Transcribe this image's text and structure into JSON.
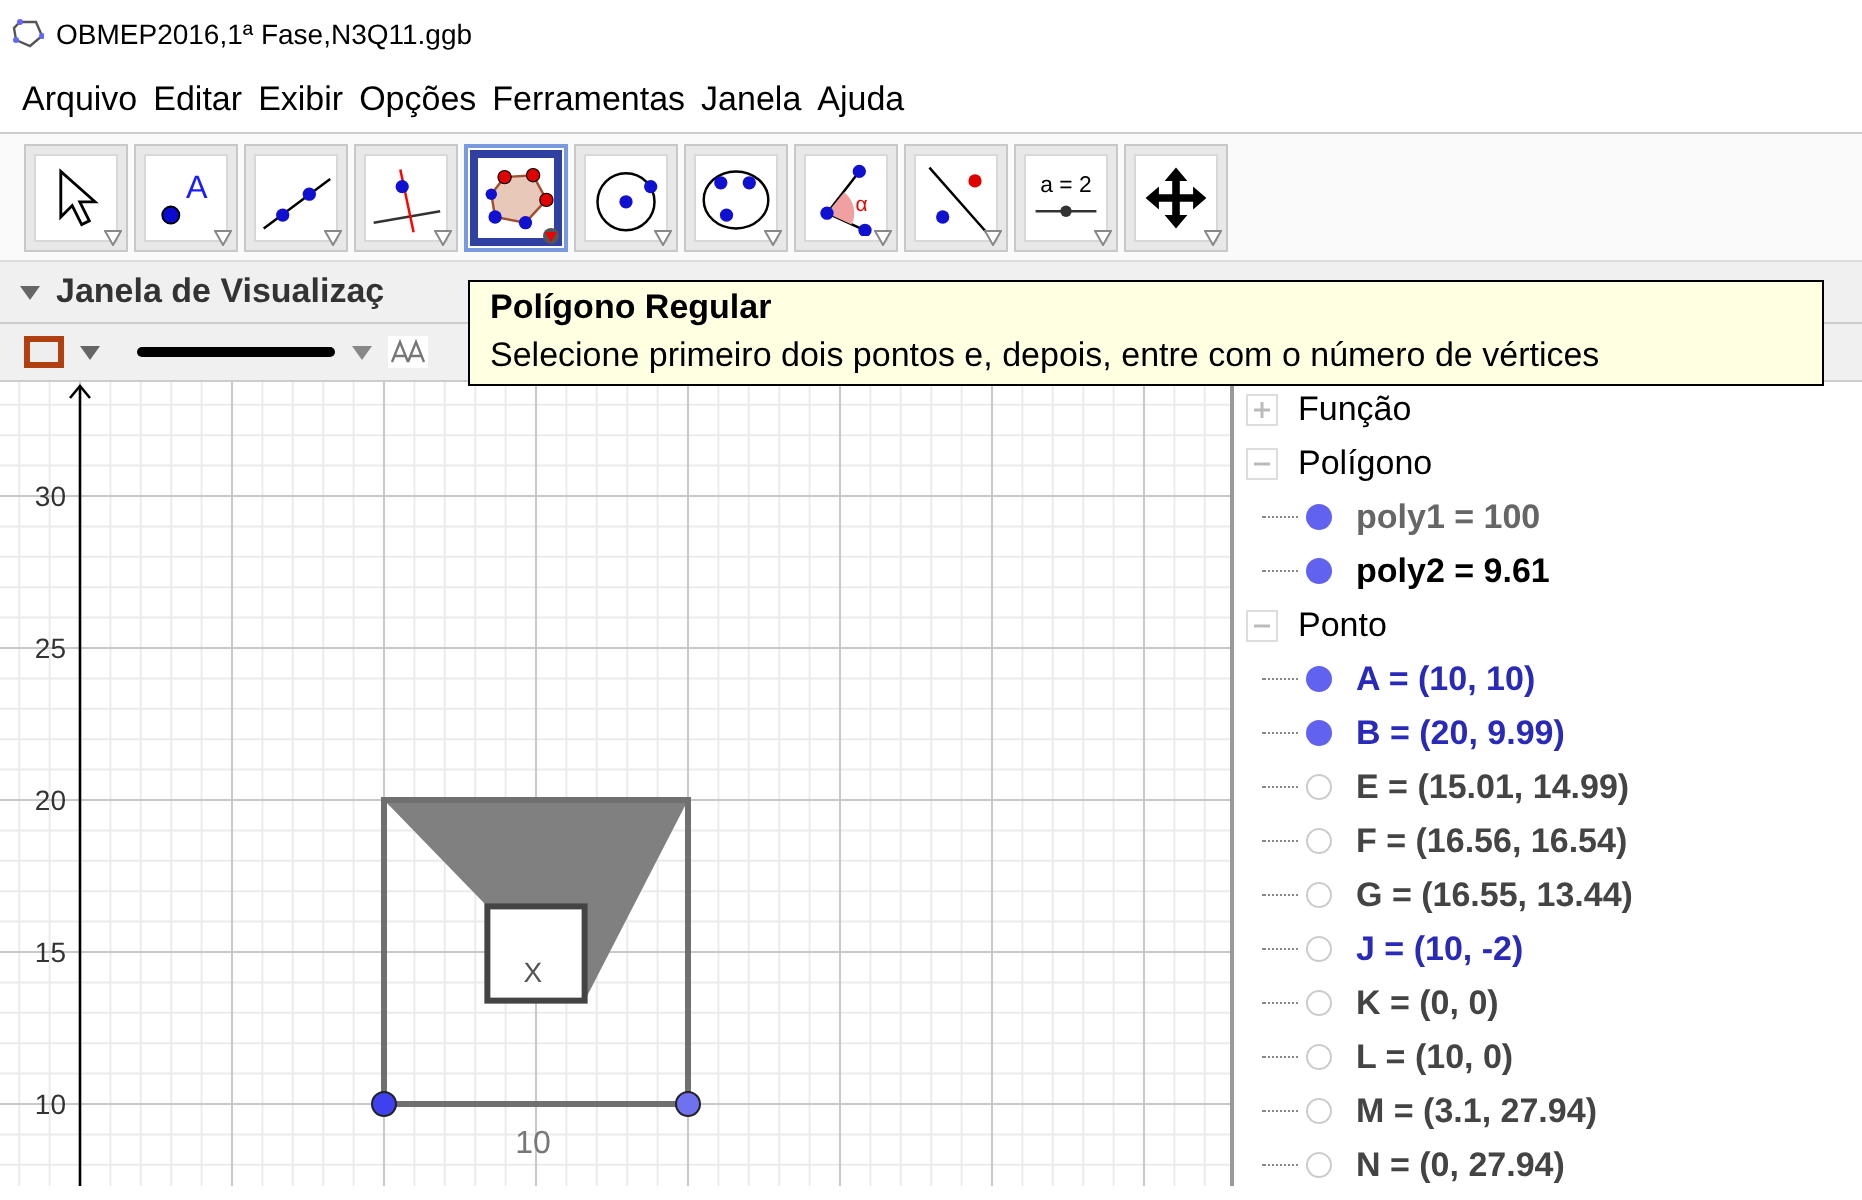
{
  "window": {
    "title": "OBMEP2016,1ª Fase,N3Q11.ggb"
  },
  "menu": [
    "Arquivo",
    "Editar",
    "Exibir",
    "Opções",
    "Ferramentas",
    "Janela",
    "Ajuda"
  ],
  "tools": [
    {
      "kind": "move",
      "selected": false
    },
    {
      "kind": "point",
      "label": "A",
      "selected": false
    },
    {
      "kind": "line",
      "selected": false
    },
    {
      "kind": "perpendicular",
      "selected": false
    },
    {
      "kind": "polygon",
      "selected": true
    },
    {
      "kind": "circle",
      "selected": false
    },
    {
      "kind": "circle3",
      "selected": false
    },
    {
      "kind": "angle",
      "label": "α",
      "selected": false
    },
    {
      "kind": "reflect",
      "selected": false
    },
    {
      "kind": "slider",
      "label": "a = 2",
      "selected": false
    },
    {
      "kind": "pan",
      "selected": false
    }
  ],
  "graphics_view": {
    "title": "Janela de Visualizaç",
    "y_axis_labels": [
      "30",
      "25",
      "20",
      "15",
      "10"
    ],
    "labels": [
      "X",
      "10"
    ]
  },
  "tooltip": {
    "title": "Polígono Regular",
    "text": "Selecione primeiro dois pontos e, depois, entre com o número de vértices"
  },
  "algebra": [
    {
      "name": "Função",
      "expanded": false
    },
    {
      "name": "Polígono",
      "expanded": true,
      "items": [
        {
          "text": "poly1 = 100",
          "visible": true,
          "color": "#666666"
        },
        {
          "text": "poly2 = 9.61",
          "visible": true,
          "color": "#000000"
        }
      ]
    },
    {
      "name": "Ponto",
      "expanded": true,
      "items": [
        {
          "text": "A = (10, 10)",
          "visible": true,
          "color": "#2a2ab8"
        },
        {
          "text": "B = (20, 9.99)",
          "visible": true,
          "color": "#2a2ab8"
        },
        {
          "text": "E = (15.01, 14.99)",
          "visible": false,
          "color": "#444444"
        },
        {
          "text": "F = (16.56, 16.54)",
          "visible": false,
          "color": "#444444"
        },
        {
          "text": "G = (16.55, 13.44)",
          "visible": false,
          "color": "#444444"
        },
        {
          "text": "J = (10, -2)",
          "visible": false,
          "color": "#2a2ab8"
        },
        {
          "text": "K = (0, 0)",
          "visible": false,
          "color": "#444444"
        },
        {
          "text": "L = (10, 0)",
          "visible": false,
          "color": "#444444"
        },
        {
          "text": "M = (3.1, 27.94)",
          "visible": false,
          "color": "#444444"
        },
        {
          "text": "N = (0, 27.94)",
          "visible": false,
          "color": "#444444"
        }
      ]
    }
  ]
}
